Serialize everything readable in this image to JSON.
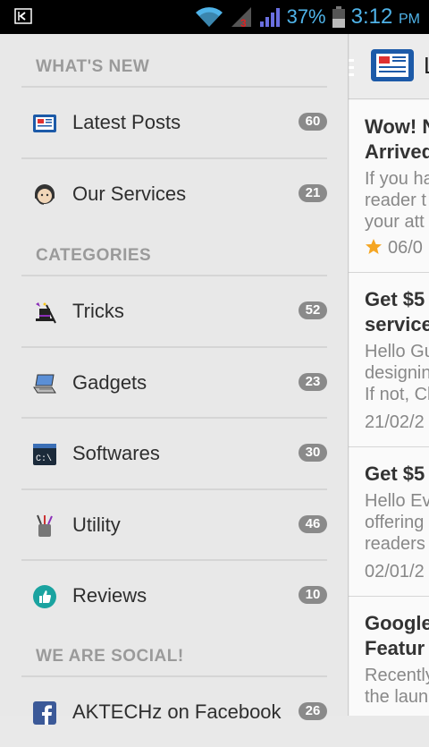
{
  "status_bar": {
    "battery_percent": "37%",
    "time": "3:12",
    "ampm": "PM",
    "signal_badge": "3"
  },
  "drawer": {
    "sections": [
      {
        "title": "WHAT'S NEW"
      },
      {
        "title": "CATEGORIES"
      },
      {
        "title": "WE ARE SOCIAL!"
      }
    ],
    "items": [
      {
        "label": "Latest Posts",
        "count": "60",
        "icon": "newspaper-icon"
      },
      {
        "label": "Our Services",
        "count": "21",
        "icon": "support-agent-icon"
      },
      {
        "label": "Tricks",
        "count": "52",
        "icon": "magic-hat-icon"
      },
      {
        "label": "Gadgets",
        "count": "23",
        "icon": "laptop-icon"
      },
      {
        "label": "Softwares",
        "count": "30",
        "icon": "terminal-icon"
      },
      {
        "label": "Utility",
        "count": "46",
        "icon": "tools-icon"
      },
      {
        "label": "Reviews",
        "count": "10",
        "icon": "thumbs-up-icon"
      },
      {
        "label": "AKTECHz on Facebook",
        "count": "26",
        "icon": "facebook-icon"
      }
    ]
  },
  "content": {
    "actionbar_title": "L",
    "posts": [
      {
        "title_lines": [
          "Wow! N",
          "Arrived"
        ],
        "excerpt_lines": [
          "If you ha",
          "reader t",
          "your att"
        ],
        "date": "06/0",
        "starred": true
      },
      {
        "title_lines": [
          "Get $5",
          "service"
        ],
        "excerpt_lines": [
          "Hello Gu",
          "designin",
          "If not, Cl"
        ],
        "date": "21/02/2",
        "starred": false
      },
      {
        "title_lines": [
          "Get $5"
        ],
        "excerpt_lines": [
          "Hello Ev",
          "offering",
          "readers"
        ],
        "date": "02/01/2",
        "starred": false
      },
      {
        "title_lines": [
          "Google",
          "Featur"
        ],
        "excerpt_lines": [
          "Recently",
          "the laun"
        ],
        "date": "",
        "starred": false
      }
    ]
  },
  "colors": {
    "status_accent": "#4fb3e8",
    "badge_bg": "#8a8a8a",
    "section_text": "#9a9a9a",
    "drawer_bg": "#e8e8e8",
    "star": "#f5a623"
  }
}
